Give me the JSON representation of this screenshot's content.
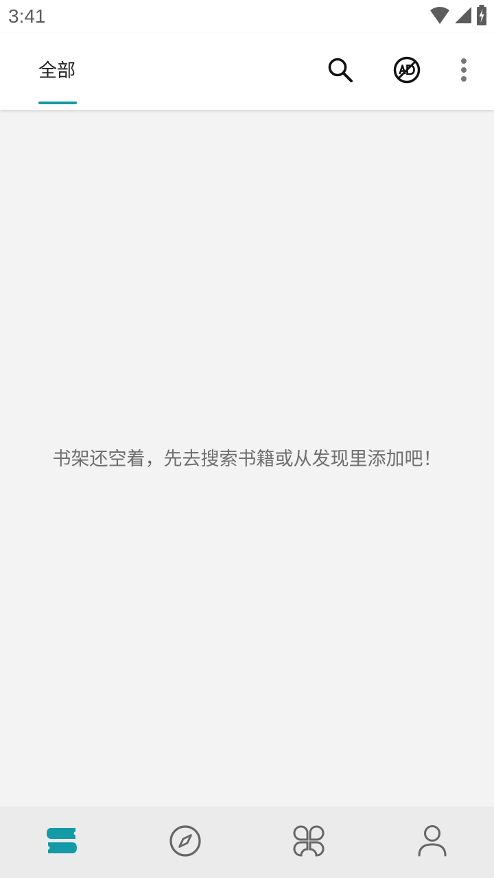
{
  "status_bar": {
    "time": "3:41",
    "icons": [
      "wifi-icon",
      "signal-icon",
      "battery-charging-icon"
    ]
  },
  "toolbar": {
    "tabs": [
      {
        "label": "全部",
        "selected": true
      }
    ],
    "actions": [
      "search-icon",
      "ad-block-icon",
      "more-vert-icon"
    ]
  },
  "main": {
    "empty_message": "书架还空着，先去搜索书籍或从发现里添加吧！"
  },
  "bottom_nav": {
    "items": [
      {
        "icon": "bookshelf-icon",
        "selected": true
      },
      {
        "icon": "compass-icon",
        "selected": false
      },
      {
        "icon": "sources-icon",
        "selected": false
      },
      {
        "icon": "profile-icon",
        "selected": false
      }
    ]
  },
  "colors": {
    "accent": "#139aa6",
    "icon_gray": "#666666",
    "background": "#f3f3f3",
    "text_gray": "#6e6e6e"
  }
}
